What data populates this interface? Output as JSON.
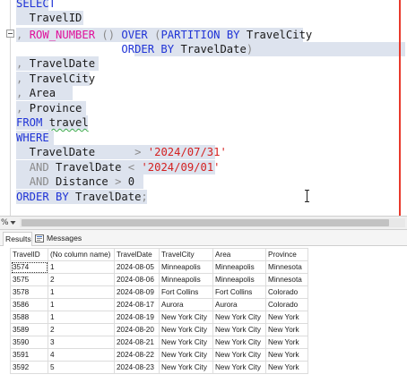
{
  "editor": {
    "code_lines": [
      [
        {
          "t": "SELECT",
          "c": "kw"
        }
      ],
      [
        {
          "t": "  TravelID",
          "c": "tx"
        }
      ],
      [
        {
          "t": ", ",
          "c": "gr"
        },
        {
          "t": "ROW_NUMBER",
          "c": "fn"
        },
        {
          "t": " () ",
          "c": "gr"
        },
        {
          "t": "OVER",
          "c": "kw"
        },
        {
          "t": " (",
          "c": "gr"
        },
        {
          "t": "PARTITION BY",
          "c": "kw"
        },
        {
          "t": " TravelCity",
          "c": "tx"
        }
      ],
      [
        {
          "t": "                ",
          "c": "tx"
        },
        {
          "t": "ORDER BY",
          "c": "kw"
        },
        {
          "t": " TravelDate",
          "c": "tx"
        },
        {
          "t": ")",
          "c": "gr"
        }
      ],
      [
        {
          "t": ", ",
          "c": "gr"
        },
        {
          "t": "TravelDate",
          "c": "tx"
        }
      ],
      [
        {
          "t": ", ",
          "c": "gr"
        },
        {
          "t": "TravelCity",
          "c": "tx"
        }
      ],
      [
        {
          "t": ", ",
          "c": "gr"
        },
        {
          "t": "Area",
          "c": "tx"
        }
      ],
      [
        {
          "t": ", ",
          "c": "gr"
        },
        {
          "t": "Province",
          "c": "tx"
        }
      ],
      [
        {
          "t": "FROM",
          "c": "kw"
        },
        {
          "t": " ",
          "c": "tx"
        },
        {
          "t": "travel",
          "c": "tx squiggle"
        }
      ],
      [
        {
          "t": "WHERE",
          "c": "kw"
        }
      ],
      [
        {
          "t": "  TravelDate      ",
          "c": "tx"
        },
        {
          "t": ">",
          "c": "op"
        },
        {
          "t": " ",
          "c": "tx"
        },
        {
          "t": "'2024/07/31'",
          "c": "str"
        }
      ],
      [
        {
          "t": "  ",
          "c": "tx"
        },
        {
          "t": "AND",
          "c": "gr"
        },
        {
          "t": " TravelDate ",
          "c": "tx"
        },
        {
          "t": "<",
          "c": "op"
        },
        {
          "t": " ",
          "c": "tx"
        },
        {
          "t": "'2024/09/01'",
          "c": "str"
        }
      ],
      [
        {
          "t": "  ",
          "c": "tx"
        },
        {
          "t": "AND",
          "c": "gr"
        },
        {
          "t": " Distance ",
          "c": "tx"
        },
        {
          "t": ">",
          "c": "op"
        },
        {
          "t": " 0",
          "c": "tx"
        }
      ],
      [
        {
          "t": "ORDER BY",
          "c": "kw"
        },
        {
          "t": " TravelDate",
          "c": "tx"
        },
        {
          "t": ";",
          "c": "gr"
        }
      ]
    ]
  },
  "zoom": {
    "label": "%"
  },
  "tabs": {
    "results": "Results",
    "messages": "Messages"
  },
  "grid": {
    "columns": [
      "TravelID",
      "(No column name)",
      "TravelDate",
      "TravelCity",
      "Area",
      "Province"
    ],
    "rows": [
      [
        "3574",
        "1",
        "2024-08-05",
        "Minneapolis",
        "Minneapolis",
        "Minnesota"
      ],
      [
        "3575",
        "2",
        "2024-08-06",
        "Minneapolis",
        "Minneapolis",
        "Minnesota"
      ],
      [
        "3578",
        "1",
        "2024-08-09",
        "Fort Collins",
        "Fort Collins",
        "Colorado"
      ],
      [
        "3586",
        "1",
        "2024-08-17",
        "Aurora",
        "Aurora",
        "Colorado"
      ],
      [
        "3588",
        "1",
        "2024-08-19",
        "New York City",
        "New York City",
        "New York"
      ],
      [
        "3589",
        "2",
        "2024-08-20",
        "New York City",
        "New York City",
        "New York"
      ],
      [
        "3590",
        "3",
        "2024-08-21",
        "New York City",
        "New York City",
        "New York"
      ],
      [
        "3591",
        "4",
        "2024-08-22",
        "New York City",
        "New York City",
        "New York"
      ],
      [
        "3592",
        "5",
        "2024-08-23",
        "New York City",
        "New York City",
        "New York"
      ]
    ]
  },
  "colors": {
    "keyword": "#1f33d6",
    "function": "#e0109b",
    "string": "#d42020",
    "highlight": "#dde3ee"
  }
}
